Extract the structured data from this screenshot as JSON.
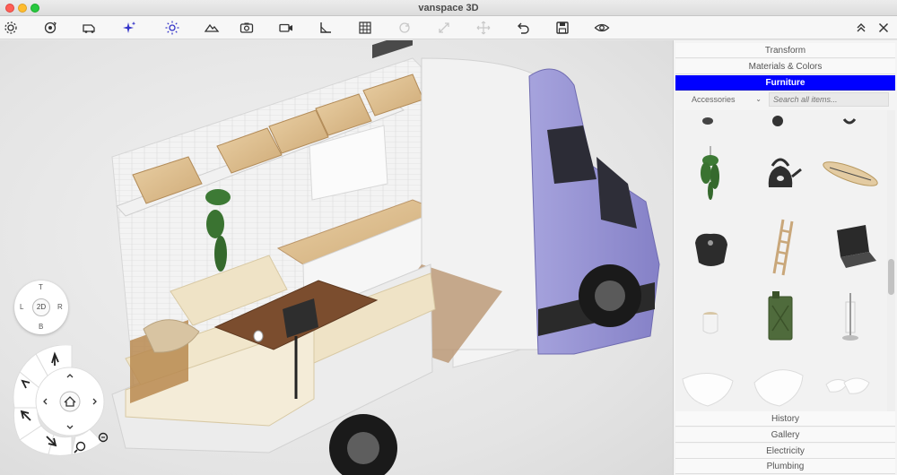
{
  "window": {
    "title": "vanspace 3D"
  },
  "toolbar": {
    "icons": [
      "gear-icon",
      "orbit-icon",
      "van-icon",
      "sparkle-icon",
      "sun-icon",
      "terrain-icon",
      "camera-icon",
      "video-icon",
      "ruler-icon",
      "grid-icon",
      "redo-disabled-icon",
      "resize-disabled-icon",
      "move-disabled-icon",
      "undo-icon",
      "save-icon",
      "eye-icon",
      "collapse-up-icon",
      "close-icon"
    ]
  },
  "panel": {
    "sections": {
      "transform": "Transform",
      "materials": "Materials & Colors",
      "furniture": "Furniture",
      "history": "History",
      "gallery": "Gallery",
      "electricity": "Electricity",
      "plumbing": "Plumbing"
    },
    "category": "Accessories",
    "search_placeholder": "Search all items...",
    "items": [
      "hanging-plant",
      "kettle",
      "surfboard",
      "dark-bag",
      "ladder",
      "laptop",
      "candle-jar",
      "jerry-can",
      "paper-towel-holder",
      "pillow",
      "cushion",
      "pillow-small"
    ]
  },
  "nav": {
    "top": "T",
    "bottom": "B",
    "left": "L",
    "right": "R",
    "center": "2D"
  },
  "colors": {
    "accent": "#0000ff",
    "van": "#8f8bd0"
  }
}
